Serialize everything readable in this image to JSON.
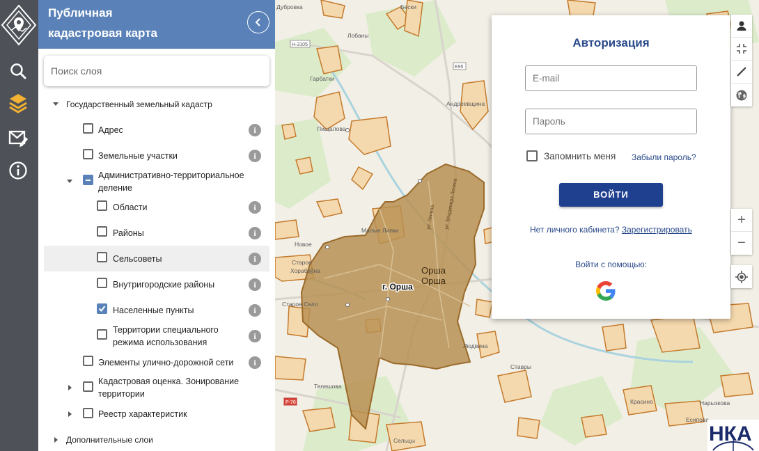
{
  "app": {
    "title_line1": "Публичная",
    "title_line2": "кадастровая карта"
  },
  "rail": {
    "items": [
      {
        "icon": "search-icon"
      },
      {
        "icon": "layers-icon"
      },
      {
        "icon": "message-edit-icon"
      },
      {
        "icon": "info-icon"
      }
    ]
  },
  "search": {
    "placeholder": "Поиск слоя"
  },
  "tree": {
    "root1": "Государственный земельный кадастр",
    "address": "Адрес",
    "parcels": "Земельные участки",
    "admin_line1": "Административно-территориальное",
    "admin_line2": "деление",
    "regions": "Области",
    "districts": "Районы",
    "selsovety": "Сельсоветы",
    "city_districts": "Внутригородские районы",
    "settlements": "Населенные пункты",
    "special_line1": "Территории специального",
    "special_line2": "режима использования",
    "roads": "Элементы улично-дорожной сети",
    "valuation_line1": "Кадастровая оценка. Зонирование",
    "valuation_line2": "территории",
    "registry": "Реестр характеристик",
    "root2": "Дополнительные слои",
    "info_glyph": "i"
  },
  "map": {
    "city_label": "г. Орша",
    "orsha1": "Орша",
    "orsha2": "Орша",
    "labels": {
      "l1": "Дубровка",
      "l2": "Бески",
      "l3": "Лобаны",
      "l4": "Гарбатки",
      "l5": "Андреевщина",
      "l6": "Пищалова",
      "l7": "Малые Липки",
      "l8": "Новое",
      "l9": "Старое",
      "l10": "Хорабаўна",
      "l11": "Старое Село",
      "l12": "Ставры",
      "l13": "Красино",
      "l14": "Есипова",
      "l15": "Сельцы",
      "l16": "Телешова",
      "l17": "Людвина",
      "l18": "Нарызкова",
      "road1": "Н-3105",
      "road2": "Е95",
      "road3": "Р-76",
      "st1": "ул. Ленина",
      "st2": "ул. Владимира Ленина"
    },
    "colors": {
      "base": "#f2efe6",
      "city_fill": "#b99054",
      "city_stroke": "#9a6a2a",
      "parcel_fill": "#f5d9ae",
      "parcel_stroke": "#c47a2c",
      "green": "#dceccb",
      "water": "#aad3df"
    }
  },
  "auth": {
    "title": "Авторизация",
    "email_placeholder": "E-mail",
    "password_placeholder": "Пароль",
    "remember": "Запомнить меня",
    "forgot": "Забыли пароль?",
    "login": "ВОЙТИ",
    "no_account": "Нет личного кабинета?",
    "register": "Зарегистрировать",
    "login_with": "Войти с помощью:",
    "provider_icon": "google-icon"
  },
  "controls": {
    "top": [
      "user-icon",
      "fullscreen-exit-icon",
      "measure-icon",
      "globe-icon"
    ],
    "zoom": [
      "zoom-in-icon",
      "zoom-out-icon"
    ],
    "locate": "locate-icon",
    "zoom_in_glyph": "+",
    "zoom_out_glyph": "−"
  }
}
